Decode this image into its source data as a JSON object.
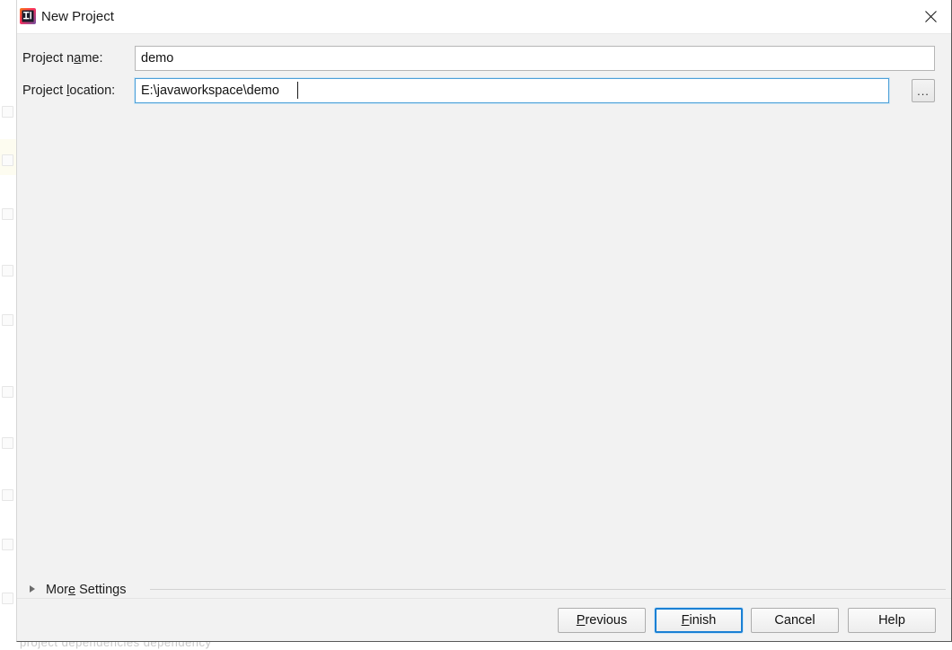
{
  "window": {
    "title": "New Project",
    "app_icon": "intellij-idea-icon",
    "close_icon": "close-icon",
    "bg_color": "#f2f2f2",
    "titlebar_color": "#ffffff"
  },
  "form": {
    "project_name": {
      "label_prefix": "Project n",
      "label_mnemonic": "a",
      "label_suffix": "me:",
      "value": "demo",
      "placeholder": ""
    },
    "project_location": {
      "label_prefix": "Project ",
      "label_mnemonic": "l",
      "label_suffix": "ocation:",
      "value": "E:\\javaworkspace\\demo",
      "placeholder": "",
      "focused": true,
      "focus_color": "#4da0d8"
    },
    "browse_button": {
      "label": "...",
      "icon": "ellipsis-icon"
    }
  },
  "more_settings": {
    "label_prefix": "Mor",
    "label_mnemonic": "e",
    "label_suffix": " Settings",
    "expanded": false,
    "triangle_icon": "chevron-right-icon"
  },
  "buttons": {
    "previous": {
      "prefix": "",
      "mnemonic": "P",
      "suffix": "revious"
    },
    "finish": {
      "prefix": "",
      "mnemonic": "F",
      "suffix": "inish",
      "focused": true,
      "focus_color": "#1a80d4"
    },
    "cancel": {
      "prefix": "Cancel",
      "mnemonic": "",
      "suffix": ""
    },
    "help": {
      "prefix": "Help",
      "mnemonic": "",
      "suffix": ""
    }
  },
  "background": {
    "bottom_fragment": "project      dependencies      dependency"
  }
}
